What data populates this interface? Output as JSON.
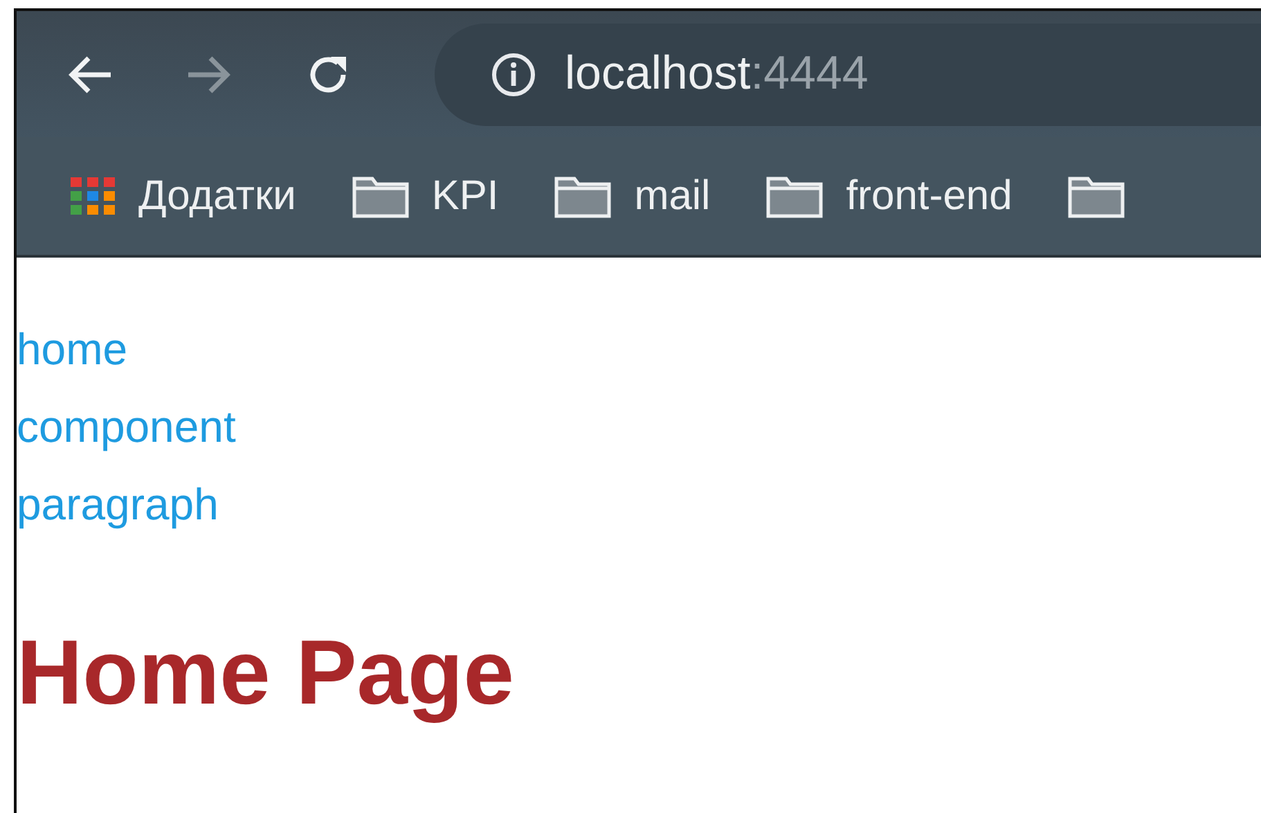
{
  "toolbar": {
    "buttons": [
      {
        "kind": "back",
        "disabled": false
      },
      {
        "kind": "forward",
        "disabled": true
      },
      {
        "kind": "reload",
        "disabled": false
      }
    ],
    "address": {
      "host": "localhost",
      "port": ":4444"
    }
  },
  "bookmarks": [
    {
      "kind": "apps",
      "label": "Додатки"
    },
    {
      "kind": "folder",
      "label": "KPI"
    },
    {
      "kind": "folder",
      "label": "mail"
    },
    {
      "kind": "folder",
      "label": "front-end"
    },
    {
      "kind": "folder"
    }
  ],
  "nav_links": [
    "home",
    "component",
    "paragraph"
  ],
  "heading": "Home Page"
}
